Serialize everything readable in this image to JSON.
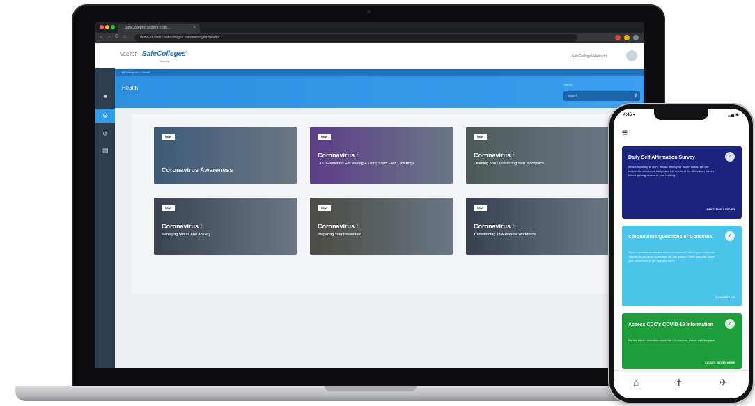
{
  "browser": {
    "tab_title": "SafeColleges Student Train...",
    "tab_close": "×",
    "url": "demo-students.safecolleges.com/training/en/health/...",
    "nav": {
      "back": "←",
      "forward": "→",
      "reload": "C",
      "home": "⌂"
    }
  },
  "app": {
    "vendor": "VECTOR",
    "brand": "SafeColleges",
    "brand_sub": "Training",
    "user_menu": "SafeCollegesStudent ▾",
    "breadcrumb": "All Categories  >  Health",
    "page_title": "Health",
    "search_label": "Search",
    "search_placeholder": "Search",
    "rail_icons": {
      "logo": "✽",
      "home": "■",
      "active": "⚙",
      "history": "↺",
      "doc": "▤"
    }
  },
  "cards": [
    {
      "badge": "NEW",
      "kicker": "",
      "title": "Coronavirus Awareness",
      "color": "#3e5a78"
    },
    {
      "badge": "NEW",
      "kicker": "Coronavirus :",
      "title": "CDC Guidelines For Making & Using Cloth Face Coverings",
      "color": "#5c3d8a"
    },
    {
      "badge": "NEW",
      "kicker": "Coronavirus :",
      "title": "Cleaning And Disinfecting Your Workplace",
      "color": "#4b5a58"
    },
    {
      "badge": "NEW",
      "kicker": "Coronavirus :",
      "title": "Managing Stress And Anxiety",
      "color": "#3b4250"
    },
    {
      "badge": "NEW",
      "kicker": "Coronavirus :",
      "title": "Preparing Your Household",
      "color": "#4a4b42"
    },
    {
      "badge": "NEW",
      "kicker": "Coronavirus :",
      "title": "Transitioning To A Remote Workforce",
      "color": "#384050"
    }
  ],
  "phone": {
    "time": "4:45 ◂",
    "status": "▂▄ ◉",
    "menu_icon": "≡",
    "cards": [
      {
        "title": "Daily Self Affirmation Survey",
        "body": "Before reporting to work, please affirm your health status. We are required to document, badge and the results of the Affirmation Survey before gaining access to your building.",
        "cta": "TAKE THE SURVEY",
        "color": "#1a237e"
      },
      {
        "title": "Coronavirus Questions or Concerns",
        "body": "Have a question or concern about coronavirus? Talk to your Corporate Contact to call Let us know how we can assist in touch with you about your concerns and get help you need.",
        "cta": "CONTACT US",
        "color": "#4cc3ea"
      },
      {
        "title": "Access CDC's COVID-19 Information",
        "body": "For the latest information about the Coronavirus, please visit this page.",
        "cta": "LEARN MORE HERE",
        "color": "#1e9e3a"
      }
    ],
    "tabs": {
      "home": "⌂",
      "walk": "☨",
      "run": "✈"
    }
  }
}
